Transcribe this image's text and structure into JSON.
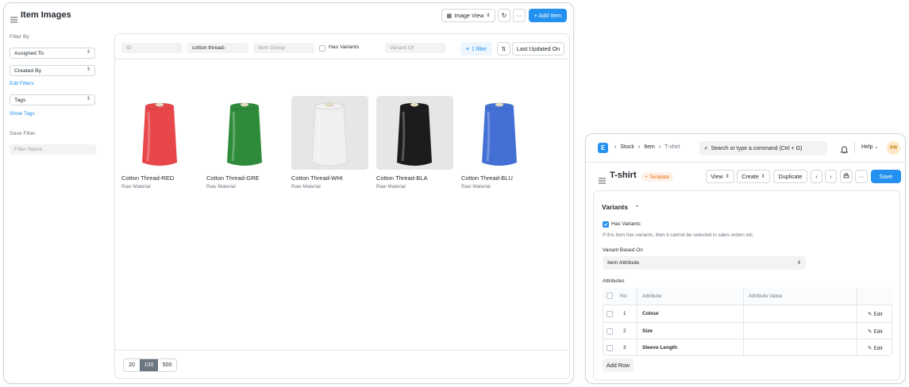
{
  "list_view": {
    "title": "Item Images",
    "view_selector": "Image View",
    "more": "···",
    "add_item": "+ Add Item",
    "sidebar": {
      "filter_by": "Filter By",
      "assigned_to": "Assigned To",
      "created_by": "Created By",
      "edit_filters": "Edit Filters",
      "tags": "Tags",
      "show_tags": "Show Tags",
      "save_filter": "Save Filter",
      "filter_name_placeholder": "Filter Name"
    },
    "filters": {
      "id_placeholder": "ID",
      "item_name_value": "cotton thread-",
      "item_group_placeholder": "Item Group",
      "has_variants": "Has Variants",
      "variant_of_placeholder": "Variant Of",
      "filter_count": "1 filter",
      "sort": "Last Updated On"
    },
    "items": [
      {
        "name": "Cotton Thread-RED",
        "group": "Raw Material",
        "color": "#e8474a"
      },
      {
        "name": "Cotton Thread-GRE",
        "group": "Raw Material",
        "color": "#2e8b3a"
      },
      {
        "name": "Cotton Thread-WHI",
        "group": "Raw Material",
        "color": "#f0f0f0"
      },
      {
        "name": "Cotton Thread-BLA",
        "group": "Raw Material",
        "color": "#1c1c1c"
      },
      {
        "name": "Cotton Thread-BLU",
        "group": "Raw Material",
        "color": "#4470d6"
      }
    ],
    "paging": [
      "20",
      "100",
      "500"
    ],
    "paging_selected": "100"
  },
  "form_view": {
    "logo": "E",
    "breadcrumbs": [
      "Stock",
      "Item",
      "T-shirt"
    ],
    "search_placeholder": "Search or type a command (Ctrl + G)",
    "help": "Help",
    "avatar": "PR",
    "title": "T-shirt",
    "status": "Template",
    "view": "View",
    "create": "Create",
    "duplicate": "Duplicate",
    "more": "···",
    "save": "Save",
    "section": "Variants",
    "has_variants": "Has Variants",
    "has_variants_desc": "If this item has variants, then it cannot be selected in sales orders etc.",
    "variant_based_on_label": "Variant Based On",
    "variant_based_on": "Item Attribute",
    "attributes_label": "Attributes",
    "table_headers": [
      "No.",
      "Attribute",
      "Attribute Value"
    ],
    "rows": [
      {
        "no": "1",
        "attribute": "Colour",
        "value": "",
        "edit": "Edit"
      },
      {
        "no": "2",
        "attribute": "Size",
        "value": "",
        "edit": "Edit"
      },
      {
        "no": "3",
        "attribute": "Sleeve Length",
        "value": "",
        "edit": "Edit"
      }
    ],
    "add_row": "Add Row"
  },
  "colors": {
    "primary": "#2490ef",
    "template_badge": "#e86c13"
  }
}
